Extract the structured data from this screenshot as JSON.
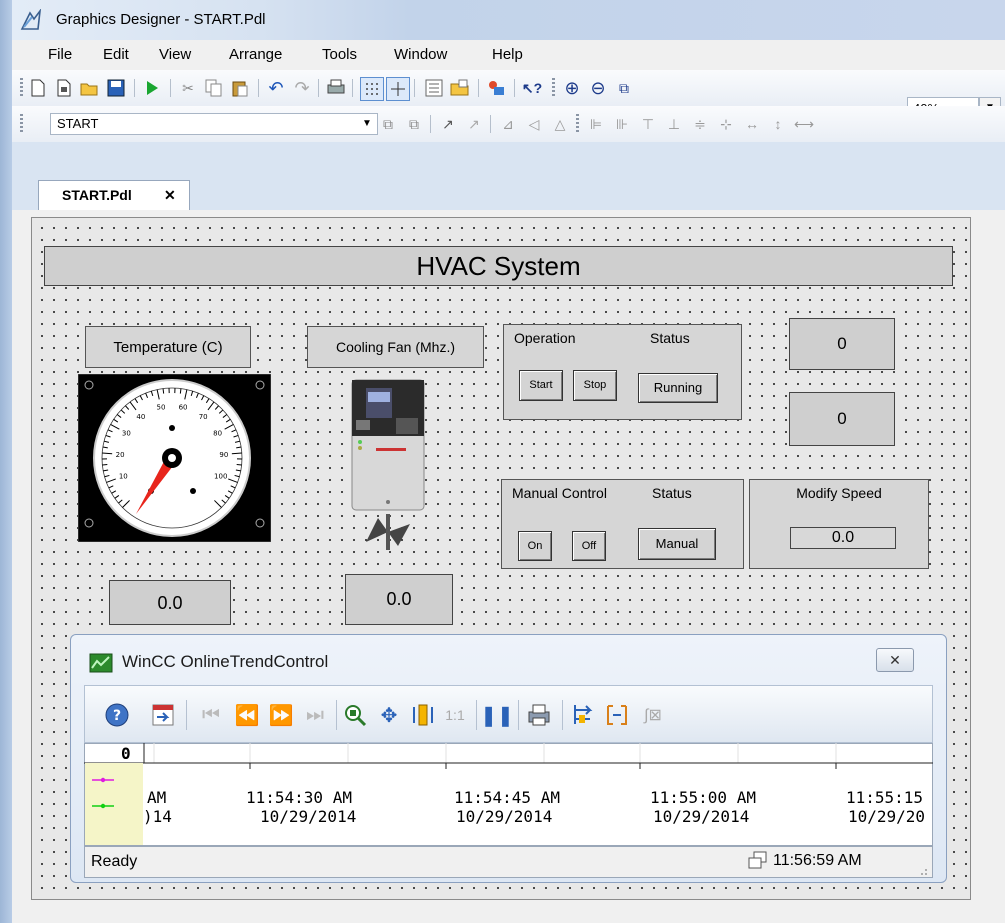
{
  "window": {
    "title": "Graphics Designer - START.Pdl"
  },
  "menu": {
    "items": [
      "File",
      "Edit",
      "View",
      "Arrange",
      "Tools",
      "Window",
      "Help"
    ]
  },
  "toolbar": {
    "zoom": "40%",
    "screen_select": "START"
  },
  "tabs": [
    {
      "label": "START.Pdl",
      "close": "✕"
    }
  ],
  "screen": {
    "header": "HVAC System",
    "temperature": {
      "label": "Temperature (C)",
      "value": "0.0",
      "gauge_ticks": [
        "10",
        "20",
        "30",
        "40",
        "50",
        "60",
        "70",
        "80",
        "90",
        "100"
      ]
    },
    "cooling_fan": {
      "label": "Cooling Fan (Mhz.)",
      "value": "0.0"
    },
    "operation": {
      "label": "Operation",
      "status_label": "Status",
      "start": "Start",
      "stop": "Stop",
      "status": "Running"
    },
    "manual_control": {
      "label": "Manual Control",
      "status_label": "Status",
      "on": "On",
      "off": "Off",
      "status": "Manual"
    },
    "modify_speed": {
      "label": "Modify Speed",
      "value": "0.0"
    },
    "display_1": "0",
    "display_2": "0"
  },
  "trend": {
    "title": "WinCC OnlineTrendControl",
    "close": "✕",
    "y_value": "0",
    "time_axis": [
      {
        "time": "AM",
        "date": ")14"
      },
      {
        "time": "11:54:30 AM",
        "date": "10/29/2014"
      },
      {
        "time": "11:54:45 AM",
        "date": "10/29/2014"
      },
      {
        "time": "11:55:00 AM",
        "date": "10/29/2014"
      },
      {
        "time": "11:55:15",
        "date": "10/29/20"
      }
    ],
    "series_colors": [
      "#e01be0",
      "#12d012"
    ],
    "status": "Ready",
    "clock": "11:56:59 AM"
  },
  "colors": {
    "titlebar": "#c8d6ec",
    "canvas": "#e8e8e8",
    "needle": "#e8251c"
  }
}
